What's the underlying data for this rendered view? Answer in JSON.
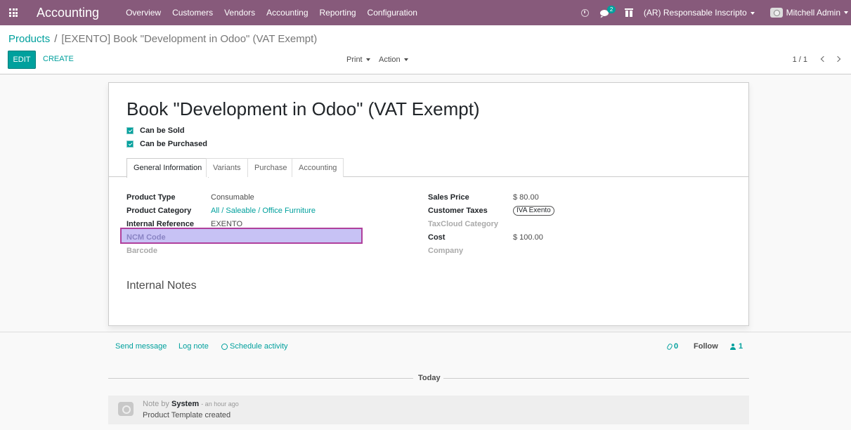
{
  "navbar": {
    "app_name": "Accounting",
    "menu": [
      "Overview",
      "Customers",
      "Vendors",
      "Accounting",
      "Reporting",
      "Configuration"
    ],
    "chat_badge": "2",
    "company": "(AR) Responsable Inscripto",
    "user": "Mitchell Admin"
  },
  "control_panel": {
    "breadcrumb_parent": "Products",
    "breadcrumb_separator": "/",
    "breadcrumb_current": "[EXENTO] Book \"Development in Odoo\" (VAT Exempt)",
    "edit_label": "EDIT",
    "create_label": "CREATE",
    "print_label": "Print",
    "action_label": "Action",
    "pager": "1 / 1"
  },
  "form": {
    "title": "Book \"Development in Odoo\" (VAT Exempt)",
    "can_be_sold": "Can be Sold",
    "can_be_purchased": "Can be Purchased",
    "tabs": [
      "General Information",
      "Variants",
      "Purchase",
      "Accounting"
    ],
    "left_fields": [
      {
        "label": "Product Type",
        "value": "Consumable"
      },
      {
        "label": "Product Category",
        "value": "All / Saleable / Office Furniture"
      },
      {
        "label": "Internal Reference",
        "value": "EXENTO"
      },
      {
        "label": "NCM Code",
        "value": ""
      },
      {
        "label": "Barcode",
        "value": ""
      }
    ],
    "right_fields": [
      {
        "label": "Sales Price",
        "value": "$ 80.00"
      },
      {
        "label": "Customer Taxes",
        "value": "IVA Exento"
      },
      {
        "label": "TaxCloud Category",
        "value": ""
      },
      {
        "label": "Cost",
        "value": "$ 100.00"
      },
      {
        "label": "Company",
        "value": ""
      }
    ],
    "internal_notes_title": "Internal Notes"
  },
  "chatter": {
    "send_message": "Send message",
    "log_note": "Log note",
    "schedule_activity": "Schedule activity",
    "attachments_count": "0",
    "follow": "Follow",
    "followers_count": "1",
    "today": "Today",
    "message": {
      "prefix": "Note by",
      "author": "System",
      "time": "- an hour ago",
      "body": "Product Template created"
    }
  },
  "colors": {
    "navbar": "#875a7b",
    "accent": "#00a09d",
    "highlight_fill": "#c7c2f5",
    "highlight_border": "#b0409c"
  }
}
